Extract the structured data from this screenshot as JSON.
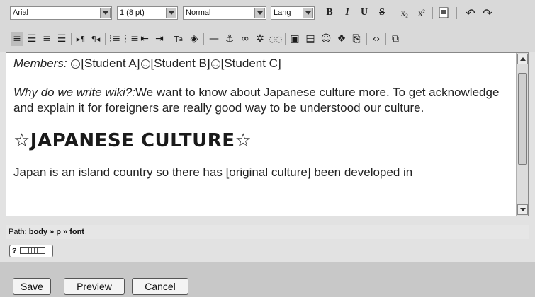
{
  "toolbar": {
    "font_family": "Arial",
    "font_size": "1 (8 pt)",
    "format": "Normal",
    "lang": "Lang",
    "bold": "B",
    "italic": "I",
    "underline": "U",
    "strike": "S",
    "subscript": "x₂",
    "superscript": "x²",
    "undo": "↶",
    "redo": "↷"
  },
  "content": {
    "members_label": "Members:",
    "student_a": "[Student A]",
    "student_b": "[Student B]",
    "student_c": "[Student C]",
    "why_label": "Why do we write wiki?:",
    "why_text": "We want to know about Japanese culture more.  To get acknowledge and explain it for foreigners are really good way to be understood our culture.",
    "heading": "☆JAPANESE CULTURE☆",
    "body_text": "Japan is an island country so there has [original culture] been developed in"
  },
  "path": {
    "label": "Path:",
    "trail": "body » p » font"
  },
  "keyboard": {
    "label": "?"
  },
  "buttons": {
    "save": "Save",
    "preview": "Preview",
    "cancel": "Cancel"
  }
}
